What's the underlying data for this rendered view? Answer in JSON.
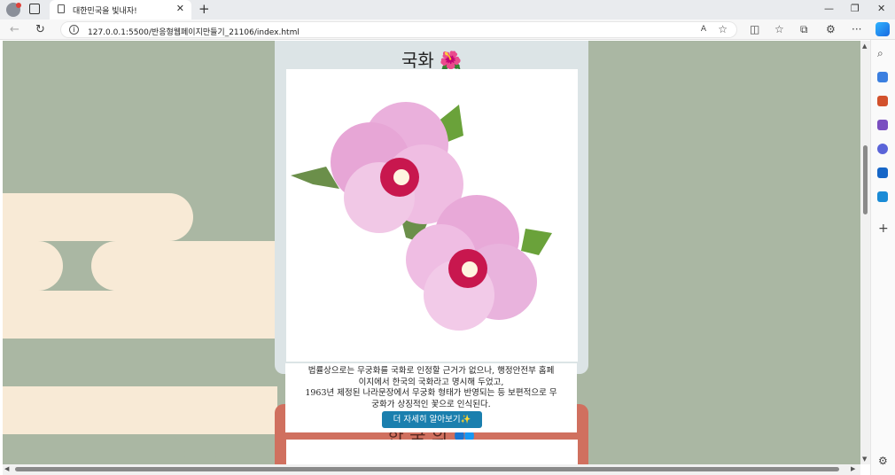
{
  "browser": {
    "tab_title": "대한민국을 빛내자!",
    "url": "127.0.0.1:5500/반응형웹페이지만들기_21106/index.html",
    "read_aloud": "A",
    "new_tab": "+",
    "close_tab": "✕",
    "back": "←",
    "refresh": "↻",
    "minimize": "—",
    "maximize": "❐",
    "close": "✕",
    "more": "···"
  },
  "page": {
    "flower_card": {
      "title": "국화",
      "emoji": "🌺",
      "description_lines": [
        "법률상으로는 무궁화를 국화로 인정할 근거가 없으나, 행정안전부 홈페",
        "이지에서 한국의 국화라고 명시해 두었고,",
        "1963년 제정된 나라문장에서 무궁화 형태가 반영되는 등 보편적으로 무",
        "궁화가 상징적인 꽃으로 인식된다."
      ],
      "more_button": "더 자세히 알아보기✨"
    },
    "next_card": {
      "title_partial": "한 국 의 👥"
    }
  },
  "colors": {
    "page_bg": "#aab7a3",
    "cloud": "#f8ead6",
    "card_bg": "#dce4e6",
    "next_card_bg": "#d0705f",
    "button_bg": "#1a7fae"
  }
}
